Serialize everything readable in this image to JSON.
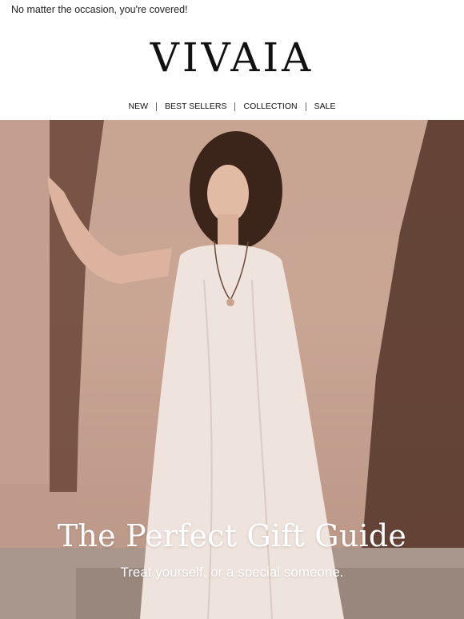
{
  "preheader": {
    "text": "No matter the occasion, you're covered!"
  },
  "brand": {
    "logo_text": "VIVAIA"
  },
  "nav": {
    "items": [
      {
        "label": "NEW"
      },
      {
        "label": "BEST SELLERS"
      },
      {
        "label": "COLLECTION"
      },
      {
        "label": "SALE"
      }
    ]
  },
  "hero": {
    "title": "The Perfect Gift Guide",
    "subtitle": "Treat yourself, or a special someone.",
    "colors": {
      "wall": "#c8a493",
      "shadow": "#5a3a2e",
      "dress": "#efe3dd",
      "floor": "#a9968c"
    }
  }
}
